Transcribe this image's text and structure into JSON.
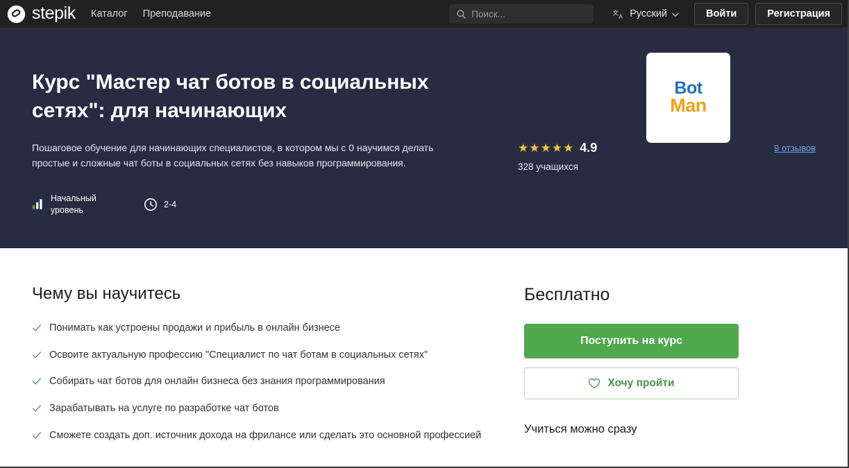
{
  "navbar": {
    "brand_name": "stepik",
    "brand_logo_icon": "stepik-logo-icon",
    "links": [
      {
        "label": "Каталог"
      },
      {
        "label": "Преподавание"
      }
    ],
    "search": {
      "placeholder": "Поиск...",
      "value": "",
      "icon": "search-icon"
    },
    "language": {
      "label": "Русский",
      "icon": "translate-icon",
      "chevron": "chevron-down-icon"
    },
    "login_label": "Войти",
    "register_label": "Регистрация"
  },
  "hero": {
    "title": "Курс \"Мастер чат ботов в социальных сетях\": для начинающих",
    "summary": "Пошаговое обучение для начинающих специалистов, в котором мы с 0 научимся делать простые и сложные чат боты в социальных сетях без навыков программирования.",
    "meta": {
      "level_icon": "signal-bars-icon",
      "level_label": "Начальный уровень",
      "duration_icon": "clock-icon",
      "duration_label": "2-4"
    },
    "cover": {
      "text_top": "Bot",
      "text_bottom": "Man",
      "color_top": "#1f6fc4",
      "color_bottom": "#f2a017"
    },
    "rating": {
      "stars_filled": 5,
      "star_glyph": "★",
      "value": "4.9",
      "learners": "328 учащихся",
      "reviews_link": "9 отзывов",
      "star_color": "#f3c13a",
      "link_color": "#6ea8e8"
    }
  },
  "main": {
    "learn_section_title": "Чему вы научитесь",
    "check_icon": "check-icon",
    "outcomes": [
      {
        "text": "Понимать как устроены продажи и прибыль в онлайн бизнесе"
      },
      {
        "text": "Освоите актуальную профессию \"Специалист по чат ботам в социальных сетях\""
      },
      {
        "text": "Собирать чат ботов для онлайн бизнеса без знания программирования"
      },
      {
        "text": "Зарабатывать на услуге по разработке чат ботов"
      },
      {
        "text": "Сможете создать доп. источник дохода на фрилансе или сделать это основной профессией"
      }
    ],
    "sidebar": {
      "price": "Бесплатно",
      "enroll_label": "Поступить на курс",
      "wish_label": "Хочу пройти",
      "wish_icon": "heart-icon",
      "availability": "Учиться можно сразу",
      "enroll_color": "#51a84f",
      "wish_color": "#46954a"
    }
  }
}
